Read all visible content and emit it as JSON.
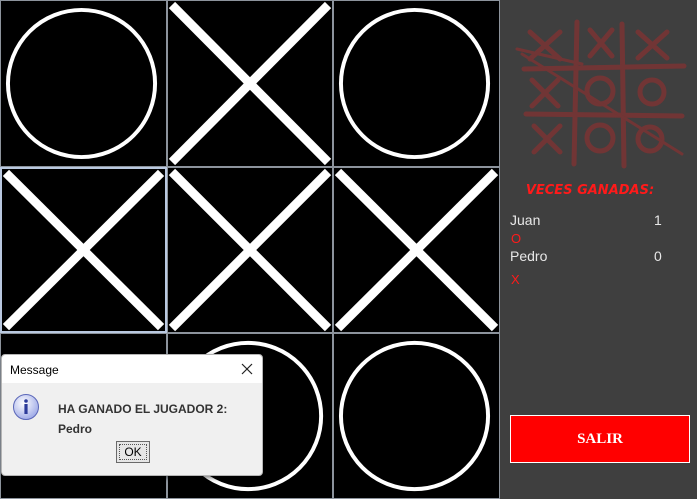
{
  "board": {
    "cells": [
      {
        "mark": "O"
      },
      {
        "mark": "X"
      },
      {
        "mark": "O"
      },
      {
        "mark": "X"
      },
      {
        "mark": "X"
      },
      {
        "mark": "X"
      },
      {
        "mark": ""
      },
      {
        "mark": "O"
      },
      {
        "mark": "O"
      }
    ]
  },
  "sidebar": {
    "logo_icon": "tic-tac-toe-logo-icon",
    "wins_title": "VECES GANADAS:",
    "players": [
      {
        "name": "Juan",
        "score": "1",
        "symbol": "O"
      },
      {
        "name": "Pedro",
        "score": "0",
        "symbol": "X"
      }
    ],
    "exit_label": "SALIR"
  },
  "dialog": {
    "title": "Message",
    "message_line1": "HA GANADO EL JUGADOR 2:",
    "message_line2": "Pedro",
    "ok_label": "OK"
  },
  "colors": {
    "accent": "#ff0000",
    "background": "#3f3f3f",
    "board": "#000000"
  }
}
